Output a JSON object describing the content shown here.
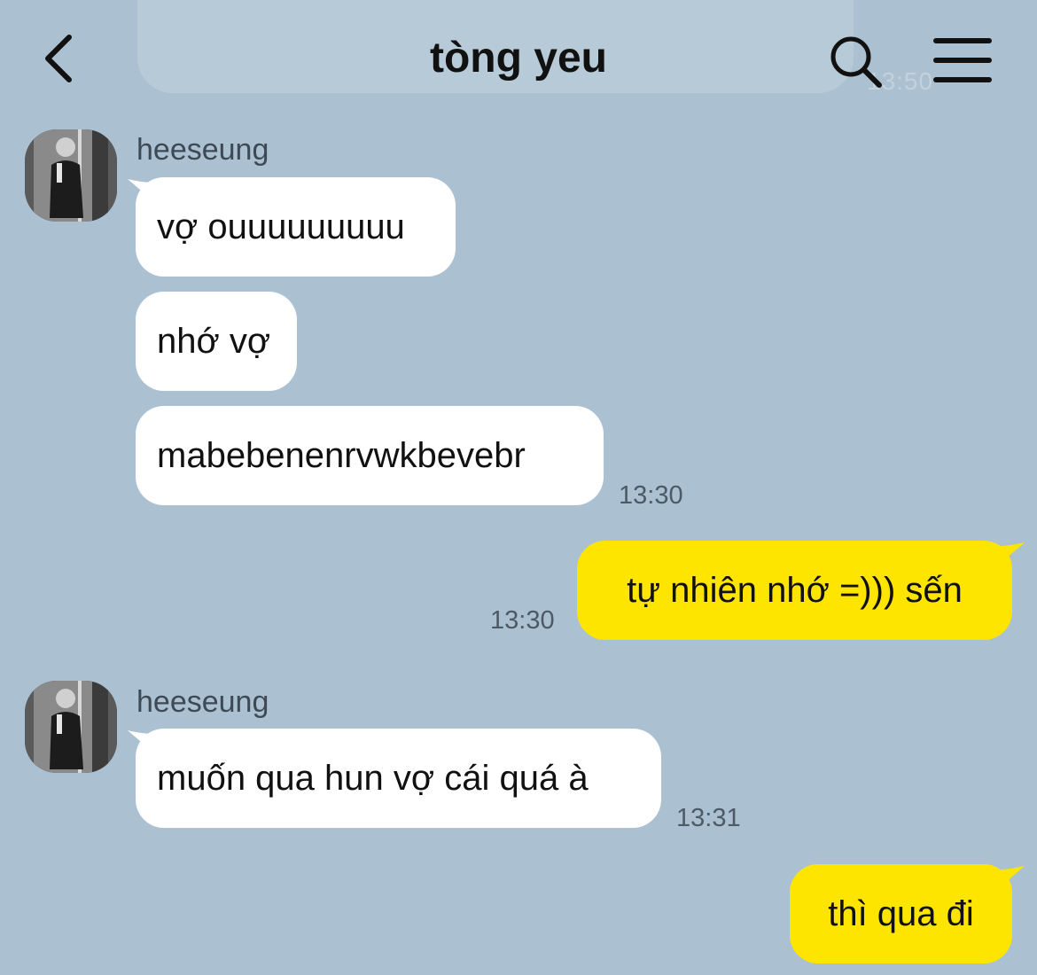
{
  "header": {
    "title": "tòng yeu",
    "back_icon": "chevron-left-icon",
    "search_icon": "search-icon",
    "menu_icon": "hamburger-menu-icon"
  },
  "ghost": {
    "time": "13:50"
  },
  "colors": {
    "background": "#abc1d2",
    "incoming_bubble": "#ffffff",
    "outgoing_bubble": "#fee500"
  },
  "messages": [
    {
      "direction": "in",
      "sender": "heeseung",
      "text": "vợ ouuuuuuuuu"
    },
    {
      "direction": "in",
      "text": "nhớ vợ"
    },
    {
      "direction": "in",
      "text": "mabebenenrvwkbevebr",
      "time": "13:30"
    },
    {
      "direction": "out",
      "text": "tự nhiên nhớ =))) sến",
      "time": "13:30"
    },
    {
      "direction": "in",
      "sender": "heeseung",
      "text": "muốn qua hun vợ cái quá à",
      "time": "13:31"
    },
    {
      "direction": "out",
      "text": "thì qua đi"
    }
  ]
}
